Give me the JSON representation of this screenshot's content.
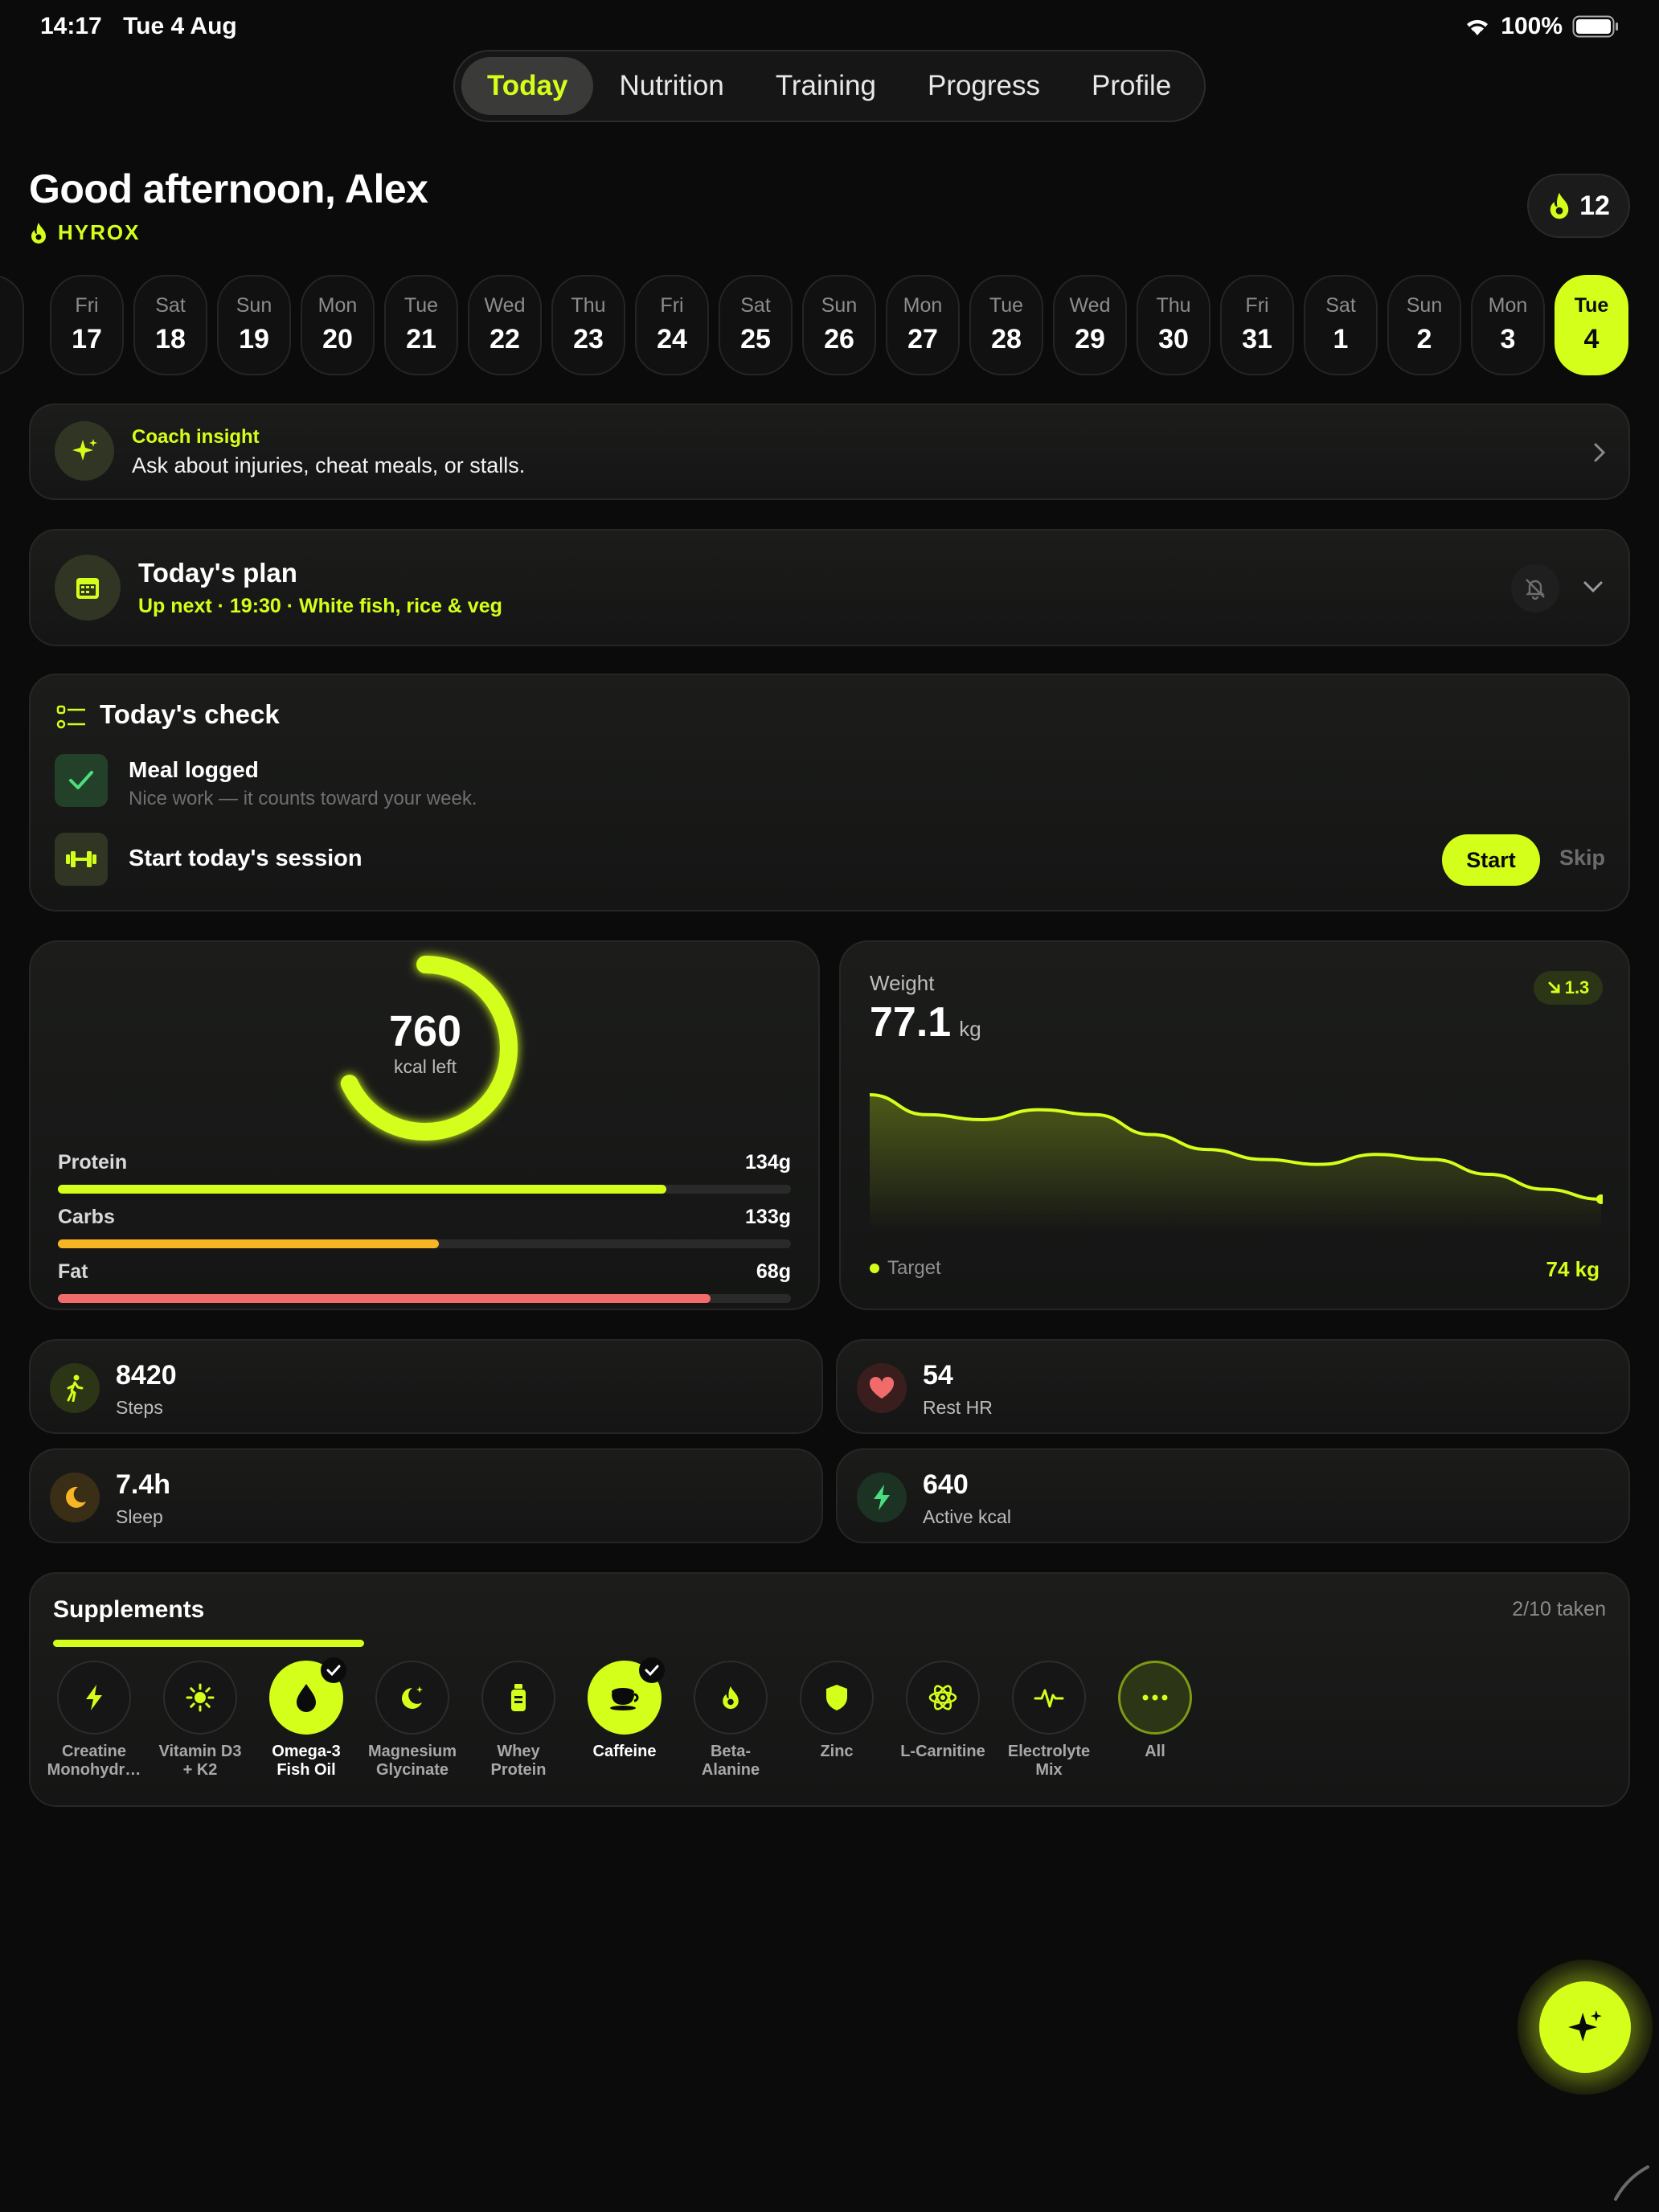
{
  "status": {
    "time": "14:17",
    "date": "Tue 4 Aug",
    "battery": "100%"
  },
  "tabs": [
    "Today",
    "Nutrition",
    "Training",
    "Progress",
    "Profile"
  ],
  "active_tab": "Today",
  "header": {
    "greeting": "Good afternoon, Alex",
    "sport": "HYROX",
    "streak": "12"
  },
  "days": [
    {
      "n": "Fri",
      "d": "17"
    },
    {
      "n": "Sat",
      "d": "18"
    },
    {
      "n": "Sun",
      "d": "19"
    },
    {
      "n": "Mon",
      "d": "20"
    },
    {
      "n": "Tue",
      "d": "21"
    },
    {
      "n": "Wed",
      "d": "22"
    },
    {
      "n": "Thu",
      "d": "23"
    },
    {
      "n": "Fri",
      "d": "24"
    },
    {
      "n": "Sat",
      "d": "25"
    },
    {
      "n": "Sun",
      "d": "26"
    },
    {
      "n": "Mon",
      "d": "27"
    },
    {
      "n": "Tue",
      "d": "28"
    },
    {
      "n": "Wed",
      "d": "29"
    },
    {
      "n": "Thu",
      "d": "30"
    },
    {
      "n": "Fri",
      "d": "31"
    },
    {
      "n": "Sat",
      "d": "1"
    },
    {
      "n": "Sun",
      "d": "2"
    },
    {
      "n": "Mon",
      "d": "3"
    },
    {
      "n": "Tue",
      "d": "4"
    }
  ],
  "coach": {
    "title": "Coach insight",
    "text": "Ask about injuries, cheat meals, or stalls."
  },
  "plan": {
    "title": "Today's plan",
    "subtitle": "Up next · 19:30 · White fish, rice & veg"
  },
  "check": {
    "title": "Today's check",
    "meal_title": "Meal logged",
    "meal_sub": "Nice work — it counts toward your week.",
    "session_title": "Start today's session",
    "start_label": "Start",
    "skip_label": "Skip"
  },
  "calories": {
    "value": "760",
    "label": "kcal left",
    "ring_fraction": 0.68
  },
  "macros": [
    {
      "name": "Protein",
      "value": "134g",
      "fraction": 0.83,
      "color": "#d4ff1a"
    },
    {
      "name": "Carbs",
      "value": "133g",
      "fraction": 0.52,
      "color": "#f6b623"
    },
    {
      "name": "Fat",
      "value": "68g",
      "fraction": 0.89,
      "color": "#f26b6b"
    }
  ],
  "weight": {
    "title": "Weight",
    "value": "77.1",
    "unit": "kg",
    "trend": "1.3",
    "target_label": "Target",
    "target_value": "74 kg"
  },
  "chart_data": {
    "type": "area",
    "title": "Weight",
    "values": [
      78.4,
      78.0,
      77.9,
      78.1,
      78.0,
      77.6,
      77.3,
      77.1,
      77.0,
      77.2,
      77.1,
      76.8,
      76.5,
      76.3
    ]
  },
  "stats": [
    {
      "value": "8420",
      "label": "Steps",
      "icon": "walking-icon"
    },
    {
      "value": "54",
      "label": "Rest HR",
      "icon": "heart-icon"
    },
    {
      "value": "7.4h",
      "label": "Sleep",
      "icon": "moon-icon"
    },
    {
      "value": "640",
      "label": "Active kcal",
      "icon": "bolt-icon"
    }
  ],
  "supplements": {
    "title": "Supplements",
    "taken": "2/10 taken",
    "progress": 0.2,
    "items": [
      {
        "l1": "Creatine",
        "l2": "Monohydr…",
        "on": false
      },
      {
        "l1": "Vitamin D3",
        "l2": "+ K2",
        "on": false
      },
      {
        "l1": "Omega-3",
        "l2": "Fish Oil",
        "on": true
      },
      {
        "l1": "Magnesium",
        "l2": "Glycinate",
        "on": false
      },
      {
        "l1": "Whey",
        "l2": "Protein",
        "on": false
      },
      {
        "l1": "Caffeine",
        "l2": "",
        "on": true
      },
      {
        "l1": "Beta-",
        "l2": "Alanine",
        "on": false
      },
      {
        "l1": "Zinc",
        "l2": "",
        "on": false
      },
      {
        "l1": "L-Carnitine",
        "l2": "",
        "on": false
      },
      {
        "l1": "Electrolyte",
        "l2": "Mix",
        "on": false
      },
      {
        "l1": "All",
        "l2": "",
        "on": false
      }
    ]
  }
}
